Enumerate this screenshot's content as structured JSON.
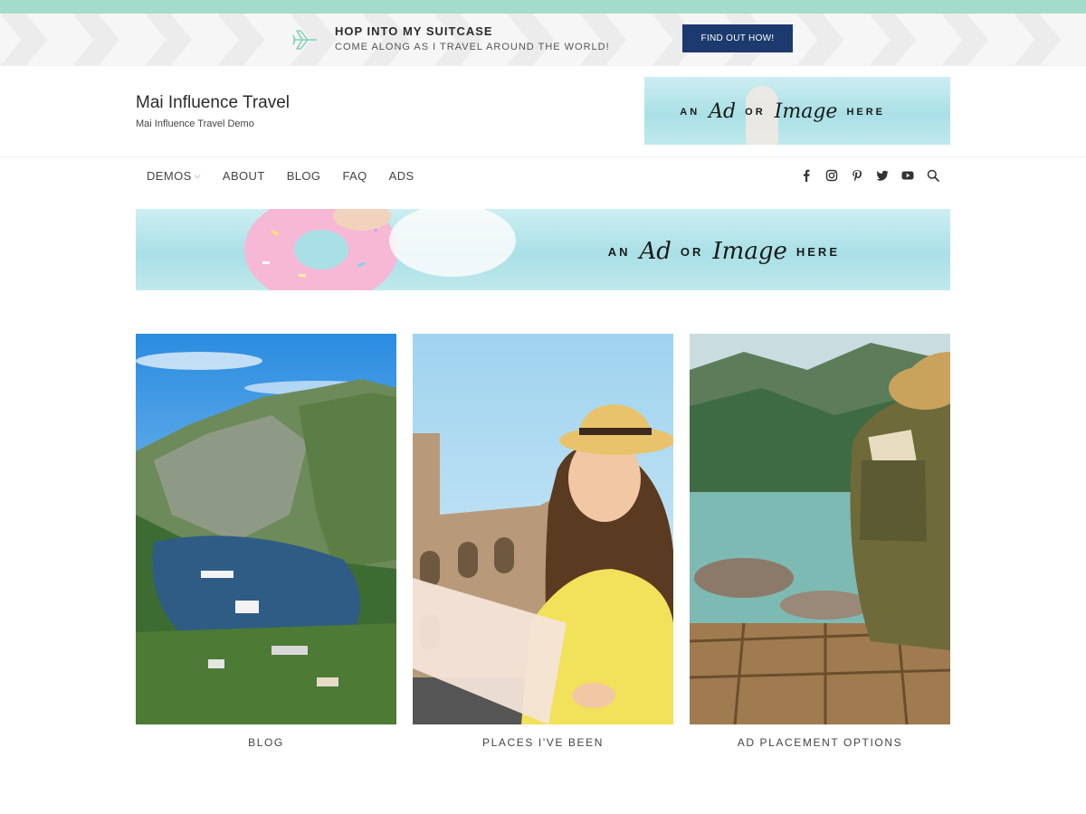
{
  "promo": {
    "title": "HOP INTO MY SUITCASE",
    "subtitle": "COME ALONG AS I TRAVEL AROUND THE WORLD!",
    "cta": "FIND OUT HOW!",
    "icon": "airplane-icon"
  },
  "header": {
    "site_title": "Mai Influence Travel",
    "site_description": "Mai Influence Travel Demo",
    "ad": {
      "word1": "AN",
      "script1": "Ad",
      "word2": "OR",
      "script2": "Image",
      "word3": "HERE"
    }
  },
  "nav": {
    "items": [
      {
        "label": "DEMOS",
        "has_dropdown": true
      },
      {
        "label": "ABOUT"
      },
      {
        "label": "BLOG"
      },
      {
        "label": "FAQ"
      },
      {
        "label": "ADS"
      }
    ],
    "dropdown_glyph": "⌵",
    "social": [
      "facebook-icon",
      "instagram-icon",
      "pinterest-icon",
      "twitter-icon",
      "youtube-icon",
      "search-icon"
    ]
  },
  "banner_ad": {
    "word1": "AN",
    "script1": "Ad",
    "word2": "OR",
    "script2": "Image",
    "word3": "HERE"
  },
  "cards": [
    {
      "label": "BLOG",
      "image": "fjord-landscape"
    },
    {
      "label": "PLACES I'VE BEEN",
      "image": "woman-with-map"
    },
    {
      "label": "AD PLACEMENT OPTIONS",
      "image": "backpack-lake"
    }
  ],
  "colors": {
    "accent_strip": "#a3dccb",
    "cta_bg": "#1c3a6e",
    "text": "#444444"
  }
}
